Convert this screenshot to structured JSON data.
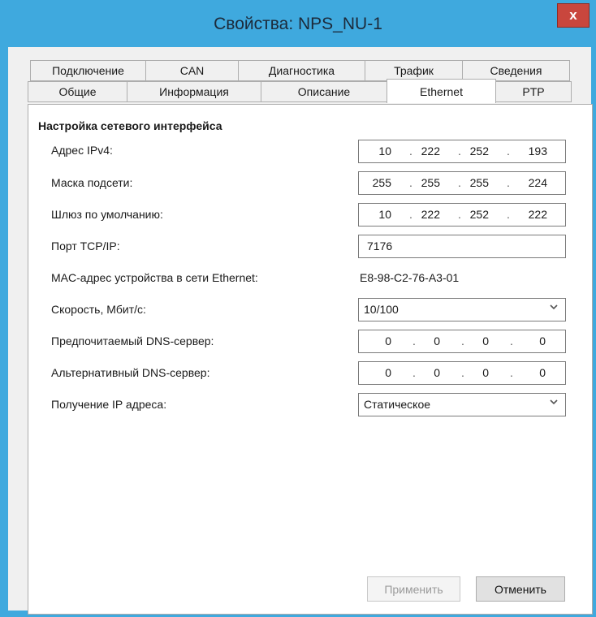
{
  "window": {
    "title": "Свойства: NPS_NU-1",
    "close": "x"
  },
  "tabs_top": [
    {
      "label": "Подключение"
    },
    {
      "label": "CAN"
    },
    {
      "label": "Диагностика"
    },
    {
      "label": "Трафик"
    },
    {
      "label": "Сведения"
    }
  ],
  "tabs_bottom": [
    {
      "label": "Общие"
    },
    {
      "label": "Информация"
    },
    {
      "label": "Описание"
    },
    {
      "label": "Ethernet"
    },
    {
      "label": "PTP"
    }
  ],
  "active_tab": "Ethernet",
  "section_title": "Настройка сетевого интерфейса",
  "fields": {
    "ipv4": {
      "label": "Адрес IPv4:",
      "octets": [
        "10",
        "222",
        "252",
        "193"
      ]
    },
    "mask": {
      "label": "Маска подсети:",
      "octets": [
        "255",
        "255",
        "255",
        "224"
      ]
    },
    "gateway": {
      "label": "Шлюз по умолчанию:",
      "octets": [
        "10",
        "222",
        "252",
        "222"
      ]
    },
    "port": {
      "label": "Порт TCP/IP:",
      "value": "7176"
    },
    "mac": {
      "label": "MAC-адрес устройства в сети Ethernet:",
      "value": "E8-98-C2-76-A3-01"
    },
    "speed": {
      "label": "Скорость, Мбит/с:",
      "value": "10/100"
    },
    "dns1": {
      "label": "Предпочитаемый DNS-сервер:",
      "octets": [
        "0",
        "0",
        "0",
        "0"
      ]
    },
    "dns2": {
      "label": "Альтернативный DNS-сервер:",
      "octets": [
        "0",
        "0",
        "0",
        "0"
      ]
    },
    "ipmode": {
      "label": "Получение IP адреса:",
      "value": "Статическое"
    }
  },
  "buttons": {
    "apply": "Применить",
    "cancel": "Отменить"
  },
  "colors": {
    "titlebar": "#3fa9de",
    "close": "#c9463d",
    "dialog_bg": "#f0f0f0"
  },
  "icons": {
    "close": "close-icon",
    "dropdown": "chevron-down-icon"
  }
}
